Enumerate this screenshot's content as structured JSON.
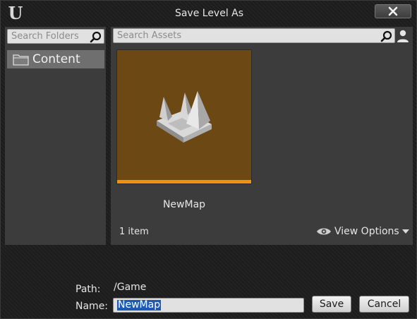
{
  "window": {
    "title": "Save Level As",
    "logo": "U"
  },
  "folders": {
    "search_placeholder": "Search Folders",
    "items": [
      {
        "label": "Content",
        "icon": "folder-icon"
      }
    ]
  },
  "assets": {
    "search_placeholder": "Search Assets",
    "items": [
      {
        "name": "NewMap",
        "type_color": "#f0920f",
        "thumb_bg": "#6b4814"
      }
    ],
    "count_text": "1 item",
    "view_options_label": "View Options"
  },
  "save": {
    "path_label": "Path:",
    "path_value": "/Game",
    "name_label": "Name:",
    "name_value": "NewMap",
    "save_label": "Save",
    "cancel_label": "Cancel"
  }
}
